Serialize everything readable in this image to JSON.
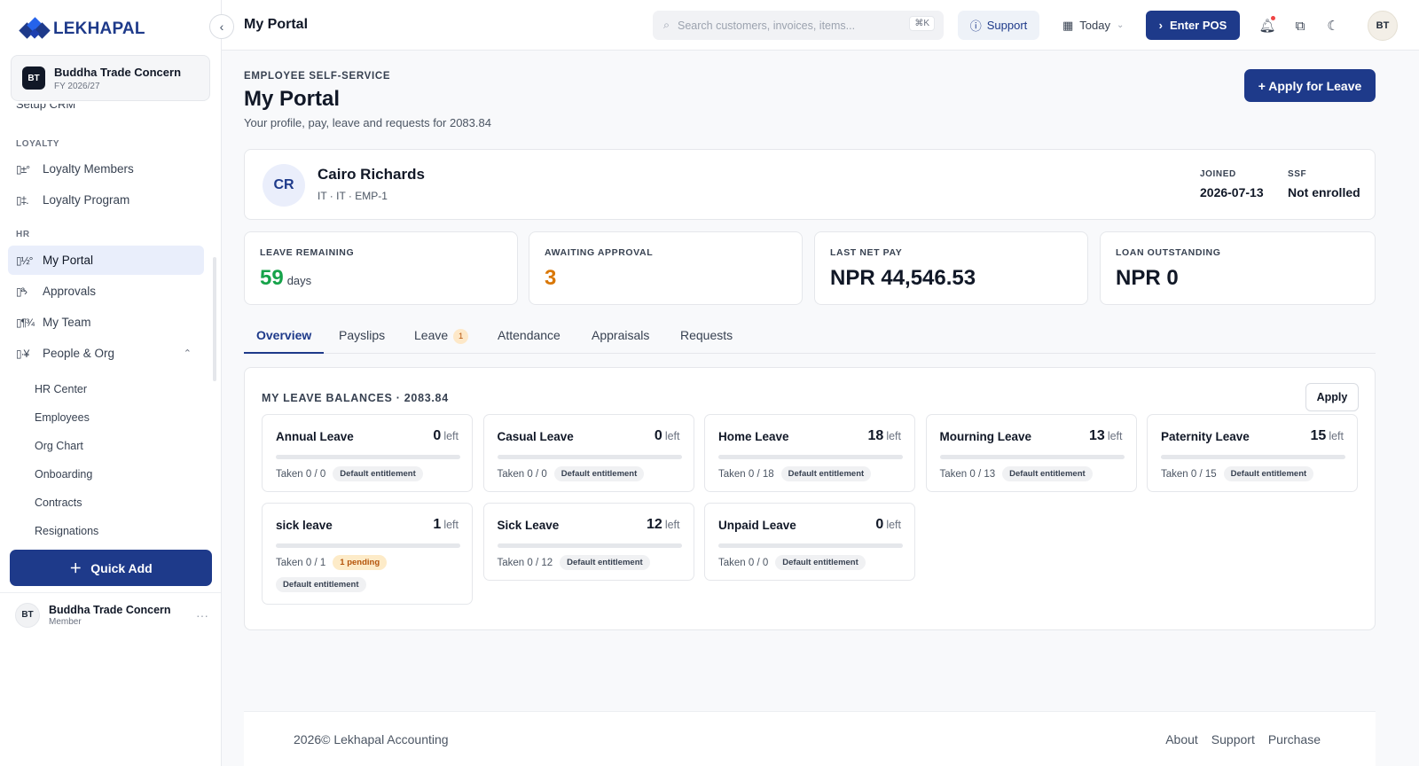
{
  "brand": {
    "name": "LEKHAPAL"
  },
  "org": {
    "initials": "BT",
    "name": "Buddha Trade Concern",
    "fy": "FY 2026/27"
  },
  "sidebar": {
    "cut_item": "Setup CRM",
    "sections": {
      "loyalty": "LOYALTY",
      "hr": "HR"
    },
    "items": [
      {
        "label": "Loyalty Members",
        "icon": "loyalty-members-icon"
      },
      {
        "label": "Loyalty Program",
        "icon": "loyalty-program-icon"
      },
      {
        "label": "My Portal",
        "icon": "my-portal-icon"
      },
      {
        "label": "Approvals",
        "icon": "approvals-icon"
      },
      {
        "label": "My Team",
        "icon": "my-team-icon"
      },
      {
        "label": "People & Org",
        "icon": "people-org-icon"
      }
    ],
    "sub_items": [
      "HR Center",
      "Employees",
      "Org Chart",
      "Onboarding",
      "Contracts",
      "Resignations"
    ],
    "quick_add": "Quick Add",
    "user": {
      "initials": "BT",
      "name": "Buddha Trade Concern",
      "role": "Member"
    }
  },
  "topbar": {
    "title": "My Portal",
    "search_placeholder": "Search customers, invoices, items...",
    "search_kbd": "⌘K",
    "support": "Support",
    "today": "Today",
    "enter_pos": "Enter POS",
    "avatar": "BT"
  },
  "page": {
    "eyebrow": "EMPLOYEE SELF-SERVICE",
    "title": "My Portal",
    "subtitle": "Your profile, pay, leave and requests for 2083.84",
    "apply_leave": "+ Apply for Leave"
  },
  "profile": {
    "initials": "CR",
    "name": "Cairo Richards",
    "meta": "IT · IT · EMP-1",
    "joined_label": "JOINED",
    "joined": "2026-07-13",
    "ssf_label": "SSF",
    "ssf": "Not enrolled"
  },
  "stats": [
    {
      "label": "LEAVE REMAINING",
      "value": "59",
      "unit": "days",
      "color": "#16a34a"
    },
    {
      "label": "AWAITING APPROVAL",
      "value": "3",
      "unit": "",
      "color": "#d97706"
    },
    {
      "label": "LAST NET PAY",
      "value": "NPR 44,546.53",
      "unit": "",
      "color": "#111827"
    },
    {
      "label": "LOAN OUTSTANDING",
      "value": "NPR 0",
      "unit": "",
      "color": "#111827"
    }
  ],
  "tabs": [
    {
      "label": "Overview"
    },
    {
      "label": "Payslips"
    },
    {
      "label": "Leave",
      "badge": "1"
    },
    {
      "label": "Attendance"
    },
    {
      "label": "Appraisals"
    },
    {
      "label": "Requests"
    }
  ],
  "balances": {
    "title": "MY LEAVE BALANCES · 2083.84",
    "apply": "Apply",
    "left_word": "left",
    "items": [
      {
        "name": "Annual Leave",
        "left": "0",
        "taken": "Taken 0 / 0",
        "chips": [
          "Default entitlement"
        ]
      },
      {
        "name": "Casual Leave",
        "left": "0",
        "taken": "Taken 0 / 0",
        "chips": [
          "Default entitlement"
        ]
      },
      {
        "name": "Home Leave",
        "left": "18",
        "taken": "Taken 0 / 18",
        "chips": [
          "Default entitlement"
        ]
      },
      {
        "name": "Mourning Leave",
        "left": "13",
        "taken": "Taken 0 / 13",
        "chips": [
          "Default entitlement"
        ]
      },
      {
        "name": "Paternity Leave",
        "left": "15",
        "taken": "Taken 0 / 15",
        "chips": [
          "Default entitlement"
        ]
      },
      {
        "name": "sick leave",
        "left": "1",
        "taken": "Taken 0 / 1",
        "pending": "1 pending",
        "chips": [
          "Default entitlement"
        ]
      },
      {
        "name": "Sick Leave",
        "left": "12",
        "taken": "Taken 0 / 12",
        "chips": [
          "Default entitlement"
        ]
      },
      {
        "name": "Unpaid Leave",
        "left": "0",
        "taken": "Taken 0 / 0",
        "chips": [
          "Default entitlement"
        ]
      }
    ]
  },
  "footer": {
    "copyright": "2026© Lekhapal Accounting",
    "links": [
      "About",
      "Support",
      "Purchase"
    ]
  }
}
